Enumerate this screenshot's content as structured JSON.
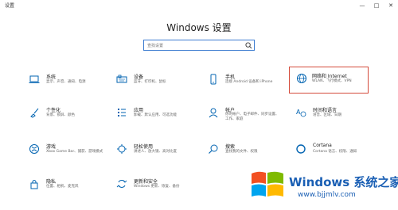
{
  "app": {
    "title": "设置"
  },
  "window_controls": {
    "minimize": "—",
    "maximize": "□",
    "close": "✕"
  },
  "page": {
    "title": "Windows 设置"
  },
  "search": {
    "placeholder": "查找设置"
  },
  "tiles": [
    {
      "key": "system",
      "icon": "laptop-icon",
      "title": "系统",
      "desc": "显示、声音、通知、电源"
    },
    {
      "key": "devices",
      "icon": "keyboard-icon",
      "title": "设备",
      "desc": "蓝牙、打印机、鼠标"
    },
    {
      "key": "phone",
      "icon": "phone-icon",
      "title": "手机",
      "desc": "连接 Android 设备和 iPhone"
    },
    {
      "key": "network",
      "icon": "globe-icon",
      "title": "网络和 Internet",
      "desc": "WLAN、飞行模式、VPN",
      "selected": true
    },
    {
      "key": "personalization",
      "icon": "brush-icon",
      "title": "个性化",
      "desc": "背景、锁屏、颜色"
    },
    {
      "key": "apps",
      "icon": "apps-list-icon",
      "title": "应用",
      "desc": "卸载、默认应用、可选功能"
    },
    {
      "key": "accounts",
      "icon": "person-icon",
      "title": "帐户",
      "desc": "你的帐户、电子邮件、同步设置、工作、家庭"
    },
    {
      "key": "time_language",
      "icon": "time-language-icon",
      "title": "时间和语言",
      "desc": "语音、区域、日期"
    },
    {
      "key": "gaming",
      "icon": "xbox-icon",
      "title": "游戏",
      "desc": "Xbox Game Bar、捕获、游戏模式"
    },
    {
      "key": "ease",
      "icon": "ease-of-access-icon",
      "title": "轻松使用",
      "desc": "讲述人、放大镜、高对比度"
    },
    {
      "key": "search",
      "icon": "magnifier-icon",
      "title": "搜索",
      "desc": "查找我的文件、权限"
    },
    {
      "key": "cortana",
      "icon": "cortana-ring-icon",
      "title": "Cortana",
      "desc": "Cortana 语言、权限、通知"
    },
    {
      "key": "privacy",
      "icon": "lock-icon",
      "title": "隐私",
      "desc": "位置、相机、麦克风"
    },
    {
      "key": "update",
      "icon": "sync-icon",
      "title": "更新和安全",
      "desc": "Windows 更新、恢复、备份"
    }
  ],
  "watermark": {
    "text": "Windows 系统之家",
    "url": "www.bjjmlv.com",
    "colors": [
      "#f25022",
      "#7fba00",
      "#00a4ef",
      "#ffb900"
    ]
  },
  "colors": {
    "accent": "#0063b1",
    "selection_border": "#d44a3a"
  }
}
